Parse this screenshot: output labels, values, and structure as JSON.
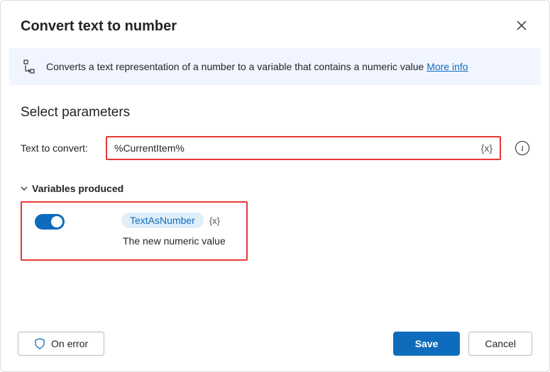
{
  "dialog": {
    "title": "Convert text to number",
    "info_text": "Converts a text representation of a number to a variable that contains a numeric value ",
    "info_link": "More info"
  },
  "parameters": {
    "section_title": "Select parameters",
    "text_to_convert_label": "Text to convert:",
    "text_to_convert_value": "%CurrentItem%",
    "variable_braces": "{x}"
  },
  "variables": {
    "header": "Variables produced",
    "toggle_on": true,
    "name": "TextAsNumber",
    "braces": "{x}",
    "description": "The new numeric value"
  },
  "footer": {
    "on_error": "On error",
    "save": "Save",
    "cancel": "Cancel"
  }
}
